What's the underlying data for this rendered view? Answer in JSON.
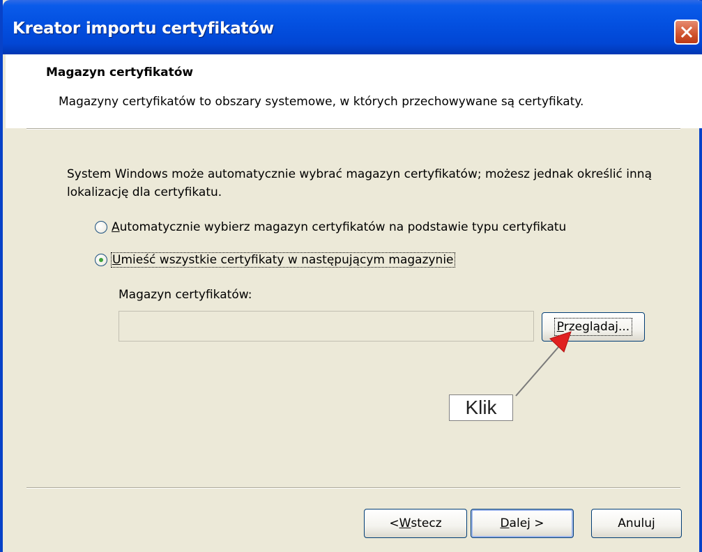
{
  "window": {
    "title": "Kreator importu certyfikatów",
    "colors": {
      "title_bar": "#0350e0",
      "dialog_bg": "#ece9d8",
      "close_button": "#d1542e"
    }
  },
  "header": {
    "title": "Magazyn certyfikatów",
    "description": "Magazyny certyfikatów to obszary systemowe, w których przechowywane są certyfikaty."
  },
  "body": {
    "paragraph": "System Windows może automatycznie wybrać magazyn certyfikatów; możesz jednak określić inną lokalizację dla certyfikatu.",
    "radio_auto": {
      "accel": "A",
      "rest": "utomatycznie wybierz magazyn certyfikatów na podstawie typu certyfikatu",
      "checked": false
    },
    "radio_manual": {
      "accel": "U",
      "rest": "mieść wszystkie certyfikaty w następującym magazynie",
      "checked": true
    },
    "store_label": "Magazyn certyfikatów:",
    "store_value": "",
    "browse": {
      "accel": "P",
      "rest": "rzeglądaj..."
    }
  },
  "annotation": {
    "text": "Klik",
    "arrow_color": "#e02020"
  },
  "footer": {
    "back": {
      "prefix": "< ",
      "accel": "W",
      "rest": "stecz"
    },
    "next": {
      "accel": "D",
      "rest": "alej >"
    },
    "cancel": "Anuluj"
  }
}
